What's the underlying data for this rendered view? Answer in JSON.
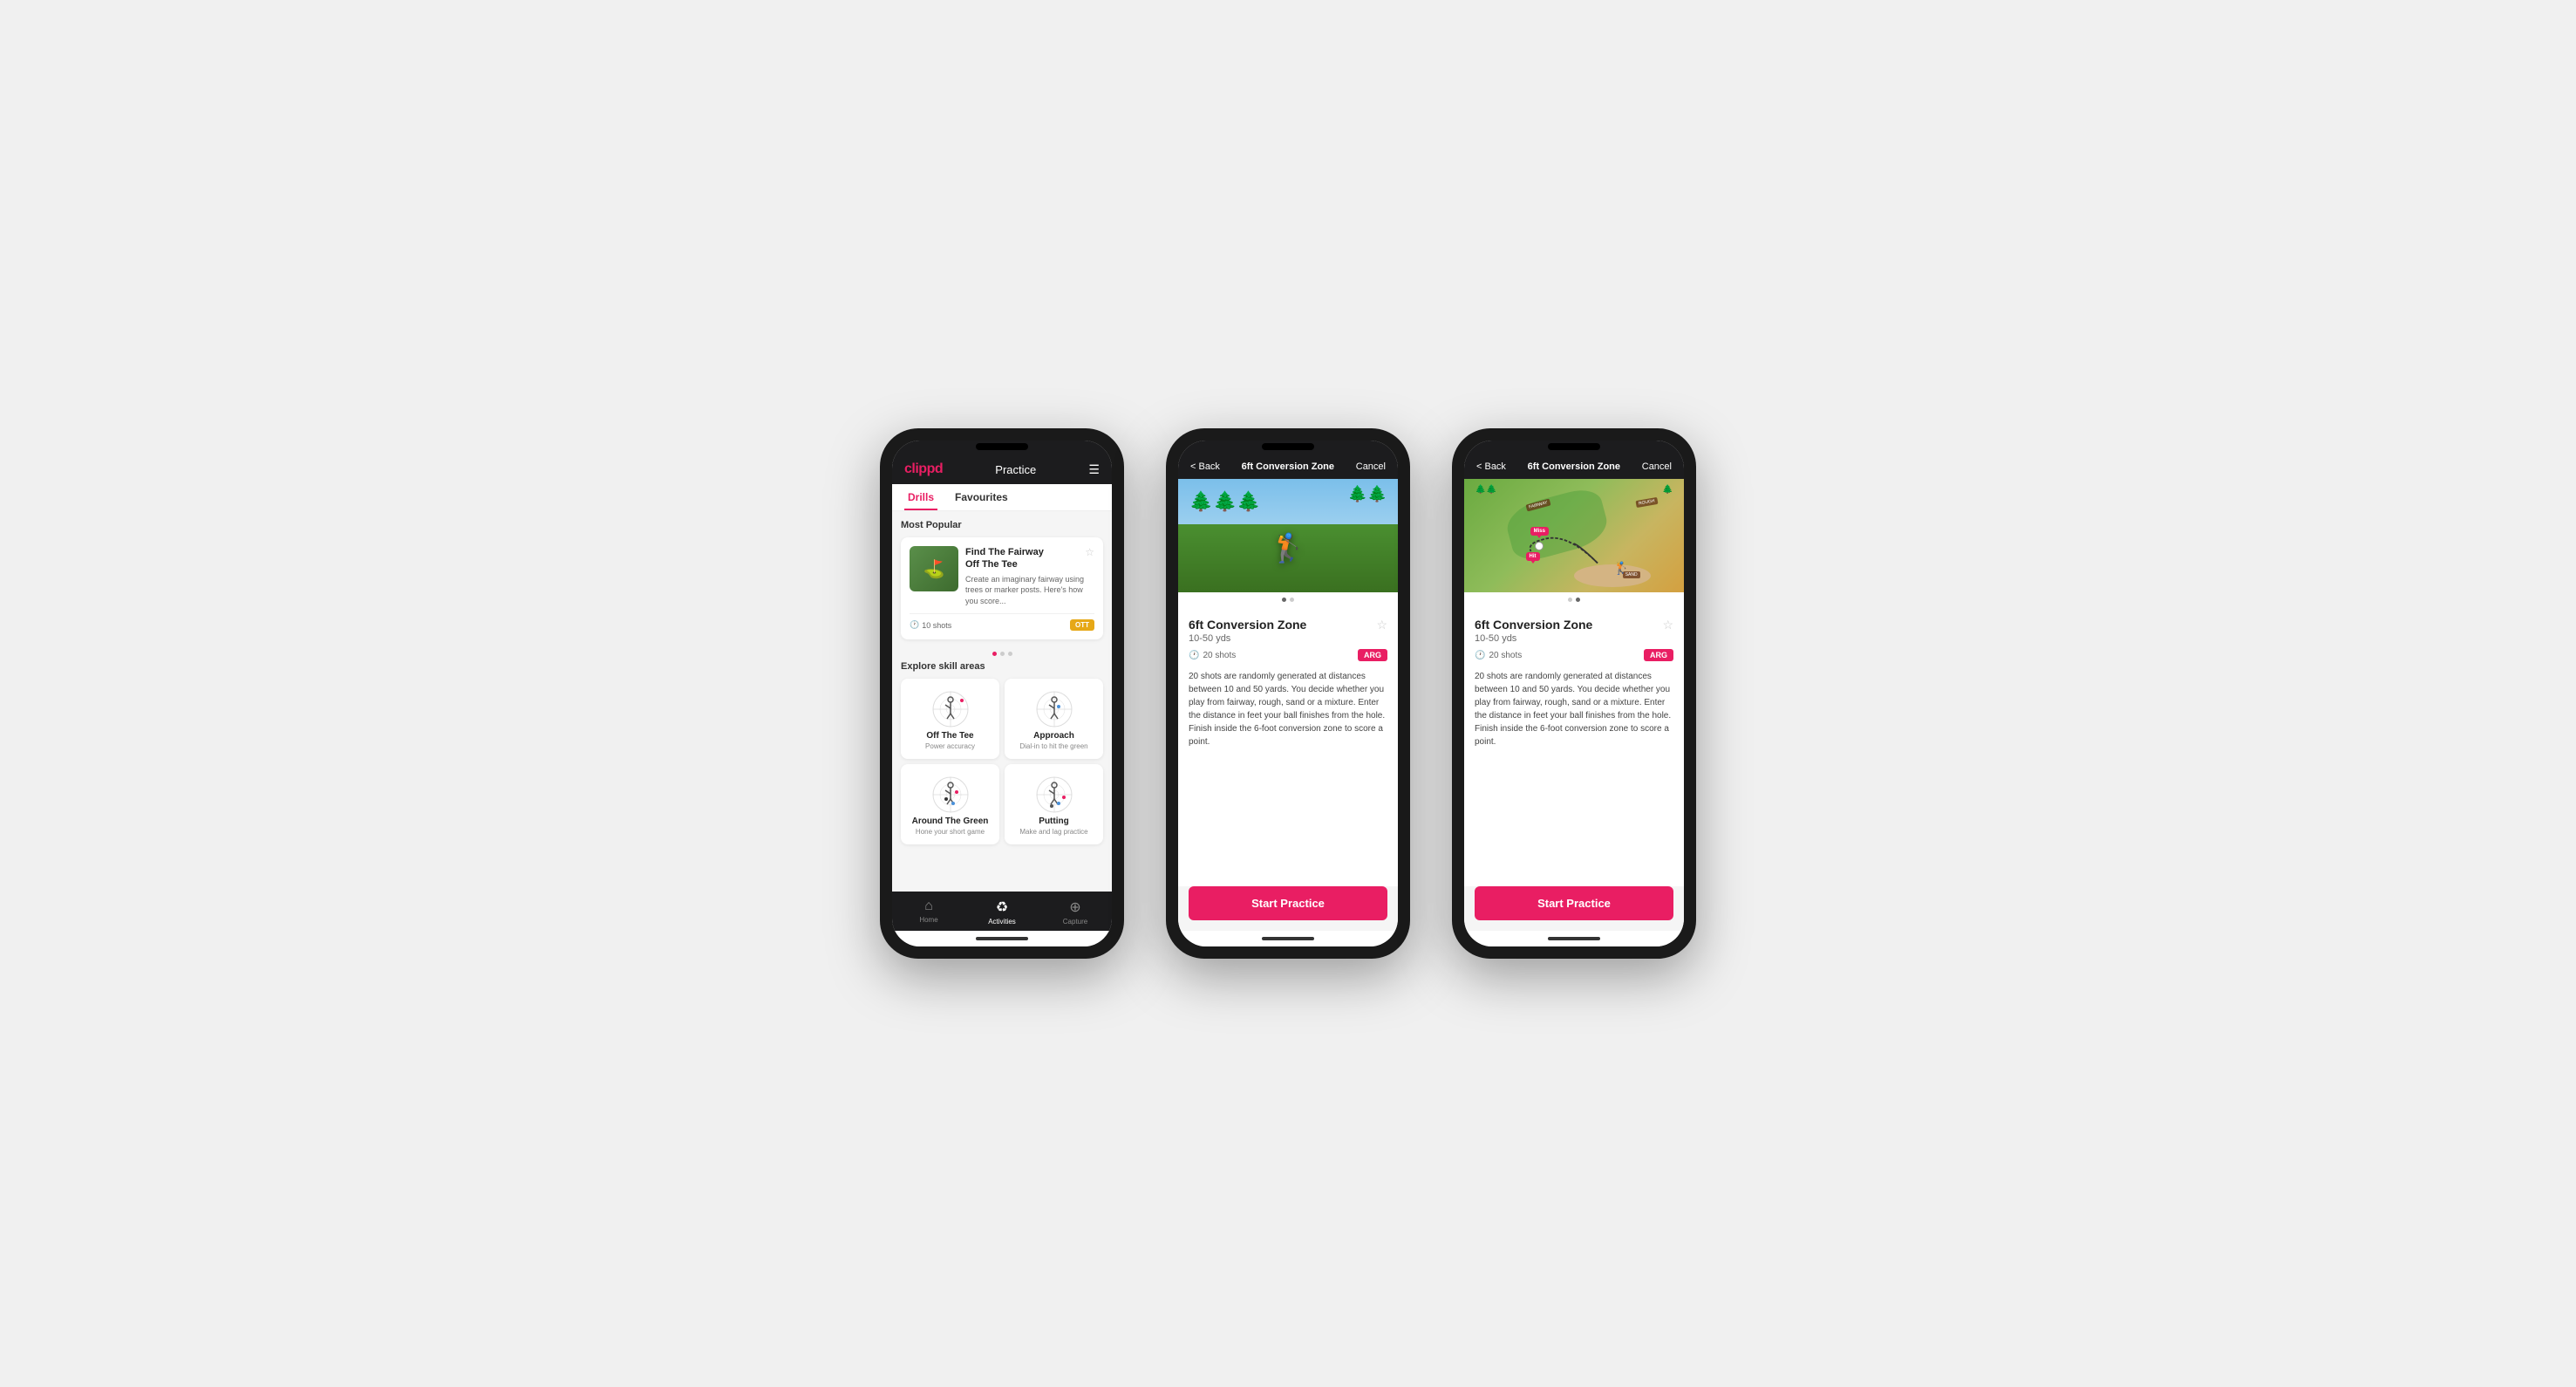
{
  "scene": {
    "bg": "#f0f0f0"
  },
  "phone1": {
    "logo": "clippd",
    "nav_title": "Practice",
    "menu_icon": "☰",
    "tabs": [
      {
        "label": "Drills",
        "active": true
      },
      {
        "label": "Favourites",
        "active": false
      }
    ],
    "most_popular_label": "Most Popular",
    "featured_card": {
      "title": "Find The Fairway",
      "subtitle": "Off The Tee",
      "description": "Create an imaginary fairway using trees or marker posts. Here's how you score...",
      "shots_label": "10 shots",
      "tag": "OTT",
      "fav_icon": "☆"
    },
    "dots": [
      true,
      false,
      false
    ],
    "explore_label": "Explore skill areas",
    "skill_areas": [
      {
        "name": "Off The Tee",
        "sub": "Power accuracy"
      },
      {
        "name": "Approach",
        "sub": "Dial-in to hit the green"
      },
      {
        "name": "Around The Green",
        "sub": "Hone your short game"
      },
      {
        "name": "Putting",
        "sub": "Make and lag practice"
      }
    ],
    "bottom_nav": [
      {
        "label": "Home",
        "icon": "⌂",
        "active": false
      },
      {
        "label": "Activities",
        "icon": "♻",
        "active": true
      },
      {
        "label": "Capture",
        "icon": "⊕",
        "active": false
      }
    ]
  },
  "phone2": {
    "back_label": "< Back",
    "header_title": "6ft Conversion Zone",
    "cancel_label": "Cancel",
    "drill_name": "6ft Conversion Zone",
    "yardage": "10-50 yds",
    "shots": "20 shots",
    "tag": "ARG",
    "fav_icon": "☆",
    "description": "20 shots are randomly generated at distances between 10 and 50 yards. You decide whether you play from fairway, rough, sand or a mixture. Enter the distance in feet your ball finishes from the hole. Finish inside the 6-foot conversion zone to score a point.",
    "start_label": "Start Practice",
    "dots": [
      true,
      false
    ]
  },
  "phone3": {
    "back_label": "< Back",
    "header_title": "6ft Conversion Zone",
    "cancel_label": "Cancel",
    "drill_name": "6ft Conversion Zone",
    "yardage": "10-50 yds",
    "shots": "20 shots",
    "tag": "ARG",
    "fav_icon": "☆",
    "description": "20 shots are randomly generated at distances between 10 and 50 yards. You decide whether you play from fairway, rough, sand or a mixture. Enter the distance in feet your ball finishes from the hole. Finish inside the 6-foot conversion zone to score a point.",
    "start_label": "Start Practice",
    "dots": [
      false,
      true
    ],
    "map_labels": [
      "FAIRWAY",
      "ROUGH",
      "SAND"
    ],
    "map_pins": [
      "Miss",
      "Hit"
    ]
  }
}
